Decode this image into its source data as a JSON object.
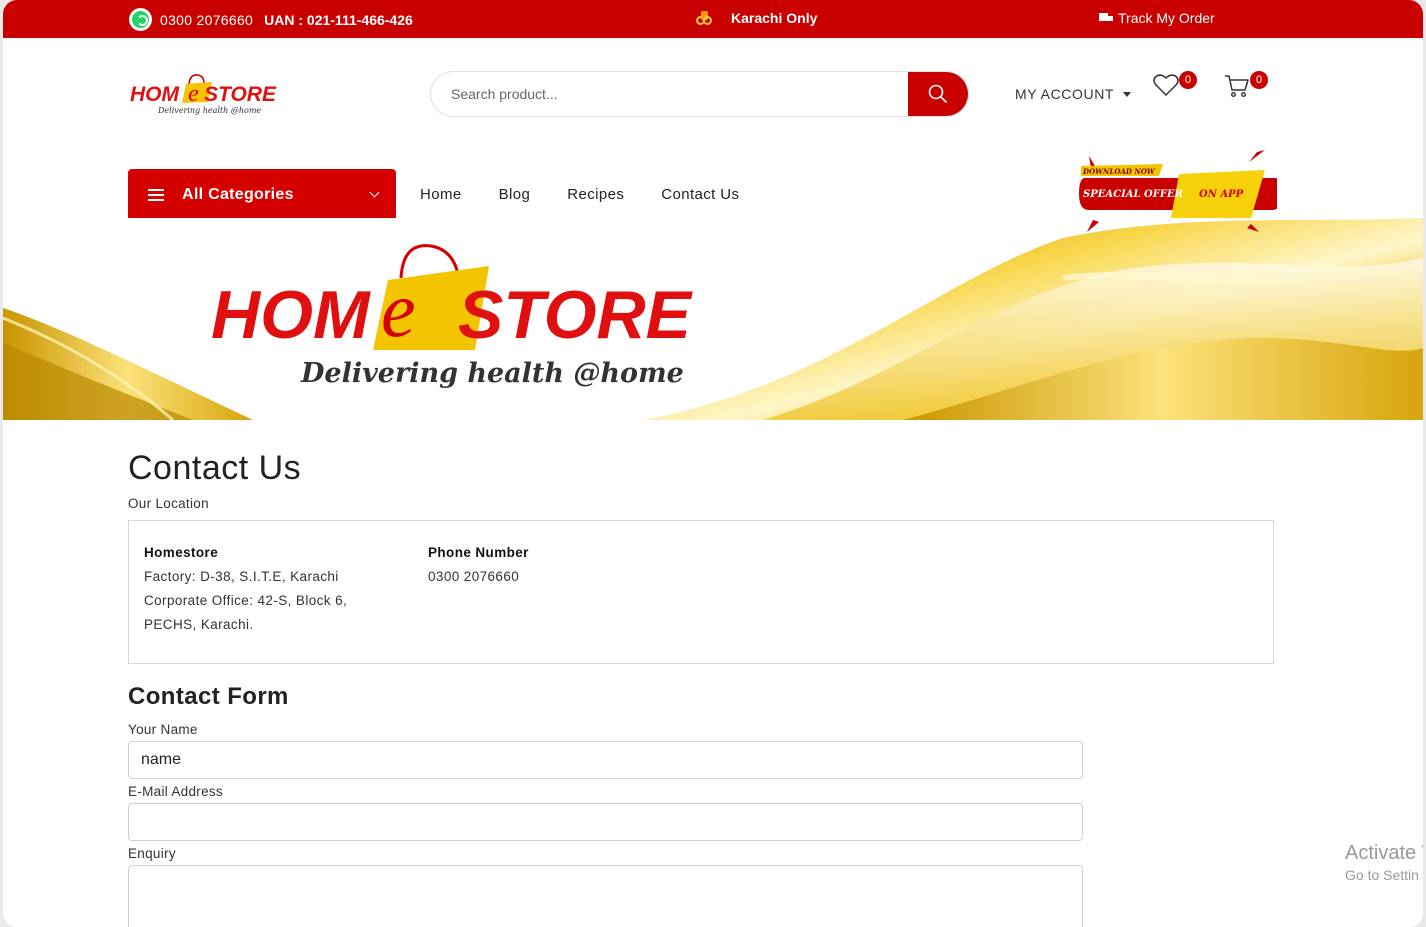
{
  "topbar": {
    "phone": "0300 2076660",
    "uan": "UAN : 021-111-466-426",
    "city": "Karachi Only",
    "track": "Track My Order"
  },
  "header": {
    "logo_text_a": "HOM",
    "logo_text_e": "e",
    "logo_text_b": "STORE",
    "tagline": "Delivering health @home",
    "search_placeholder": "Search product...",
    "account_label": "MY ACCOUNT",
    "wishlist_count": "0",
    "cart_count": "0"
  },
  "nav": {
    "categories_label": "All Categories",
    "links": [
      "Home",
      "Blog",
      "Recipes",
      "Contact Us"
    ]
  },
  "promo": {
    "line1": "DOWNLOAD NOW",
    "line2": "SPEACIAL OFFER",
    "line3": "ON APP"
  },
  "banner": {
    "logo_text_a": "HOM",
    "logo_text_e": "e",
    "logo_text_b": "STORE",
    "tagline": "Delivering health @home"
  },
  "page": {
    "title": "Contact Us",
    "location_label": "Our Location",
    "store_name": "Homestore",
    "address_lines": [
      "Factory: D-38, S.I.T.E, Karachi",
      "Corporate Office: 42-S, Block 6,",
      "PECHS, Karachi."
    ],
    "phone_heading": "Phone Number",
    "phone_value": "0300 2076660",
    "form_title": "Contact Form",
    "name_label": "Your Name",
    "name_value": "name",
    "email_label": "E-Mail Address",
    "enquiry_label": "Enquiry"
  },
  "watermark": {
    "title": "Activate W",
    "sub": "Go to Settin"
  },
  "colors": {
    "brand_red": "#c80000",
    "brand_yellow": "#f5c400",
    "text": "#222222"
  }
}
